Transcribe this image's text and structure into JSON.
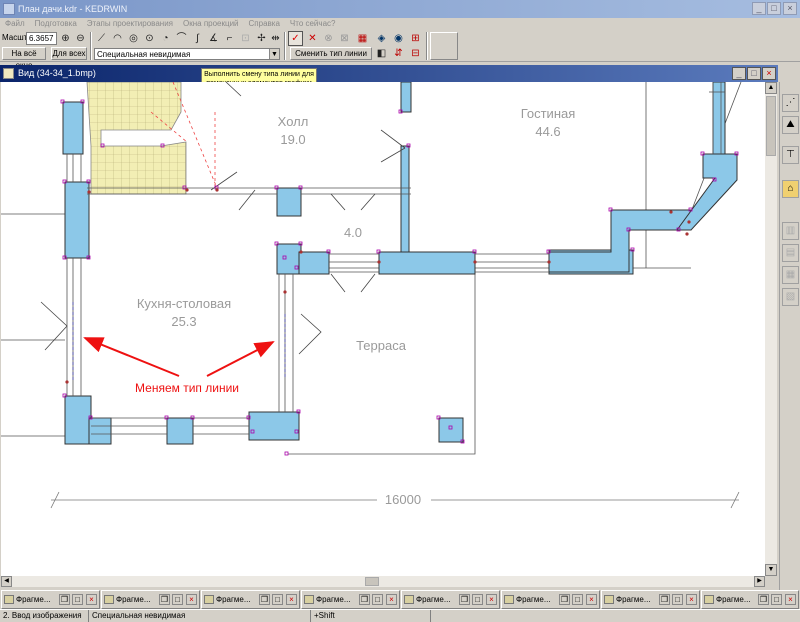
{
  "window": {
    "title": "План дачи.kdr - KEDRWIN"
  },
  "menu": [
    "Файл",
    "Подготовка",
    "Этапы проектирования",
    "Окна проекций",
    "Справка",
    "Что сейчас?"
  ],
  "toolbar": {
    "scale_label": "Масшт",
    "scale_value": "6.3657",
    "fit_button": "На всё окно",
    "for_all_button": "Для всех",
    "line_type_select": "Специальная невидимая",
    "change_line_type_button": "Сменить тип линии"
  },
  "tooltip": "Выполнить смену типа линии для помеченных элементов графики",
  "child_window": {
    "title": "Вид (34-34_1.bmp)"
  },
  "drawing": {
    "rooms": [
      {
        "name": "Холл",
        "area": "19.0"
      },
      {
        "name": "Гостиная",
        "area": "44.6"
      },
      {
        "name": "",
        "area": "4.0"
      },
      {
        "name": "Кухня-столовая",
        "area": "25.3"
      },
      {
        "name": "Терраса",
        "area": ""
      }
    ],
    "dimension": "16000",
    "annotation": "Меняем тип линии",
    "wall_color": "#8cc8e8",
    "stair_color": "#f2eeb4",
    "annotation_color": "#e11111"
  },
  "taskbar": {
    "items": [
      "Фрагме...",
      "Фрагме...",
      "Фрагме...",
      "Фрагме...",
      "Фрагме...",
      "Фрагме...",
      "Фрагме...",
      "Фрагме..."
    ]
  },
  "statusbar": {
    "stage": "2. Ввод изображения",
    "line_type": "Специальная невидимая",
    "modifier": "+Shift"
  }
}
